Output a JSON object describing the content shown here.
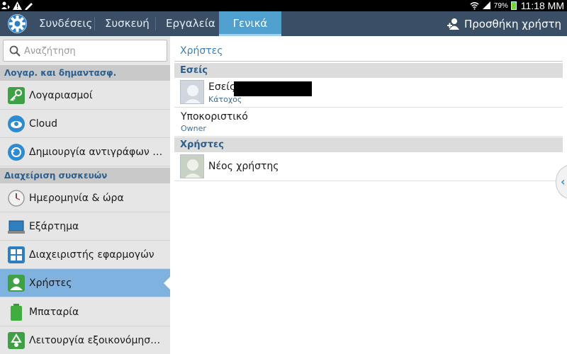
{
  "status_bar": {
    "battery": "79%",
    "time": "11:18 MM"
  },
  "topbar": {
    "tabs": [
      {
        "label": "Συνδέσεις"
      },
      {
        "label": "Συσκευή"
      },
      {
        "label": "Εργαλεία"
      },
      {
        "label": "Γενικά",
        "active": true
      }
    ],
    "add_user_label": "Προσθήκη χρήστη"
  },
  "sidebar": {
    "search_placeholder": "Αναζήτηση",
    "sections": [
      {
        "header": "Λογαρ. και δημαντασφ."
      },
      {
        "header": "Διαχείριση συσκευών"
      }
    ],
    "items": [
      {
        "label": "Λογαριασμοί",
        "icon": "key-icon"
      },
      {
        "label": "Cloud",
        "icon": "cloud-icon"
      },
      {
        "label": "Δημιουργία αντιγράφων ασφ...",
        "icon": "backup-icon"
      },
      {
        "label": "Ημερομηνία & ώρα",
        "icon": "clock-icon"
      },
      {
        "label": "Εξάρτημα",
        "icon": "accessory-icon"
      },
      {
        "label": "Διαχειριστής εφαρμογών",
        "icon": "apps-grid-icon"
      },
      {
        "label": "Χρήστες",
        "icon": "user-icon",
        "selected": true
      },
      {
        "label": "Μπαταρία",
        "icon": "battery-icon"
      },
      {
        "label": "Λειτουργία εξοικονόμησης ε...",
        "icon": "recycle-icon"
      }
    ]
  },
  "main": {
    "title": "Χρήστες",
    "groups": [
      {
        "header": "Εσείς",
        "rows": [
          {
            "title": "Εσείς",
            "subtitle": "Κάτοχος"
          },
          {
            "title": "Υποκοριστικό",
            "subtitle": "Owner"
          }
        ]
      },
      {
        "header": "Χρήστες",
        "rows": [
          {
            "title": "Νέος χρήστης"
          }
        ]
      }
    ]
  },
  "colors": {
    "topbar": "#3a4f65",
    "active_tab": "#4fa0ce",
    "selected_item": "#7fb2df",
    "section_text": "#2b5f8f"
  }
}
